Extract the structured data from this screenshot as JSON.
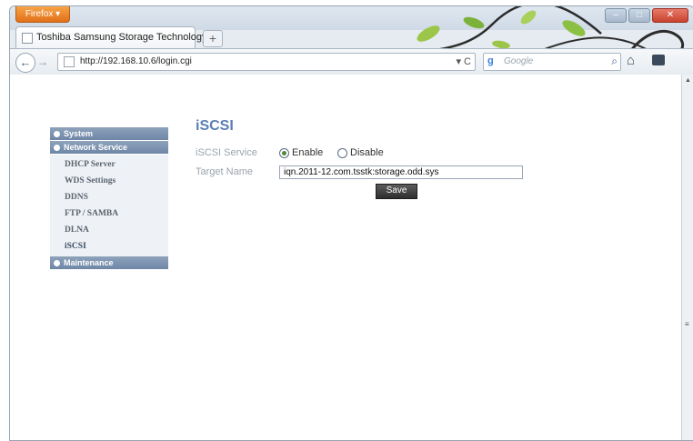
{
  "browser": {
    "menu_button": "Firefox ▾",
    "tab_title": "Toshiba Samsung Storage Technology",
    "new_tab": "+",
    "url": "http://192.168.10.6/login.cgi",
    "search_placeholder": "Google",
    "search_engine_glyph": "g",
    "back_glyph": "←",
    "forward_glyph": "→",
    "home_glyph": "⌂",
    "magnifier_glyph": "⌕"
  },
  "sidebar": {
    "system": "System",
    "network_service": "Network Service",
    "items": [
      "DHCP Server",
      "WDS Settings",
      "DDNS",
      "FTP / SAMBA",
      "DLNA",
      "iSCSI"
    ],
    "maintenance": "Maintenance"
  },
  "main": {
    "title": "iSCSI",
    "iscsi_service_label": "iSCSI Service",
    "enable_label": "Enable",
    "disable_label": "Disable",
    "target_name_label": "Target Name",
    "target_name_value": "iqn.2011-12.com.tsstk:storage.odd.sys",
    "save_label": "Save"
  },
  "colors": {
    "accent": "#5b7fb5",
    "sidebar_header": "#7a90ae",
    "save_button": "#3a3a3a"
  }
}
